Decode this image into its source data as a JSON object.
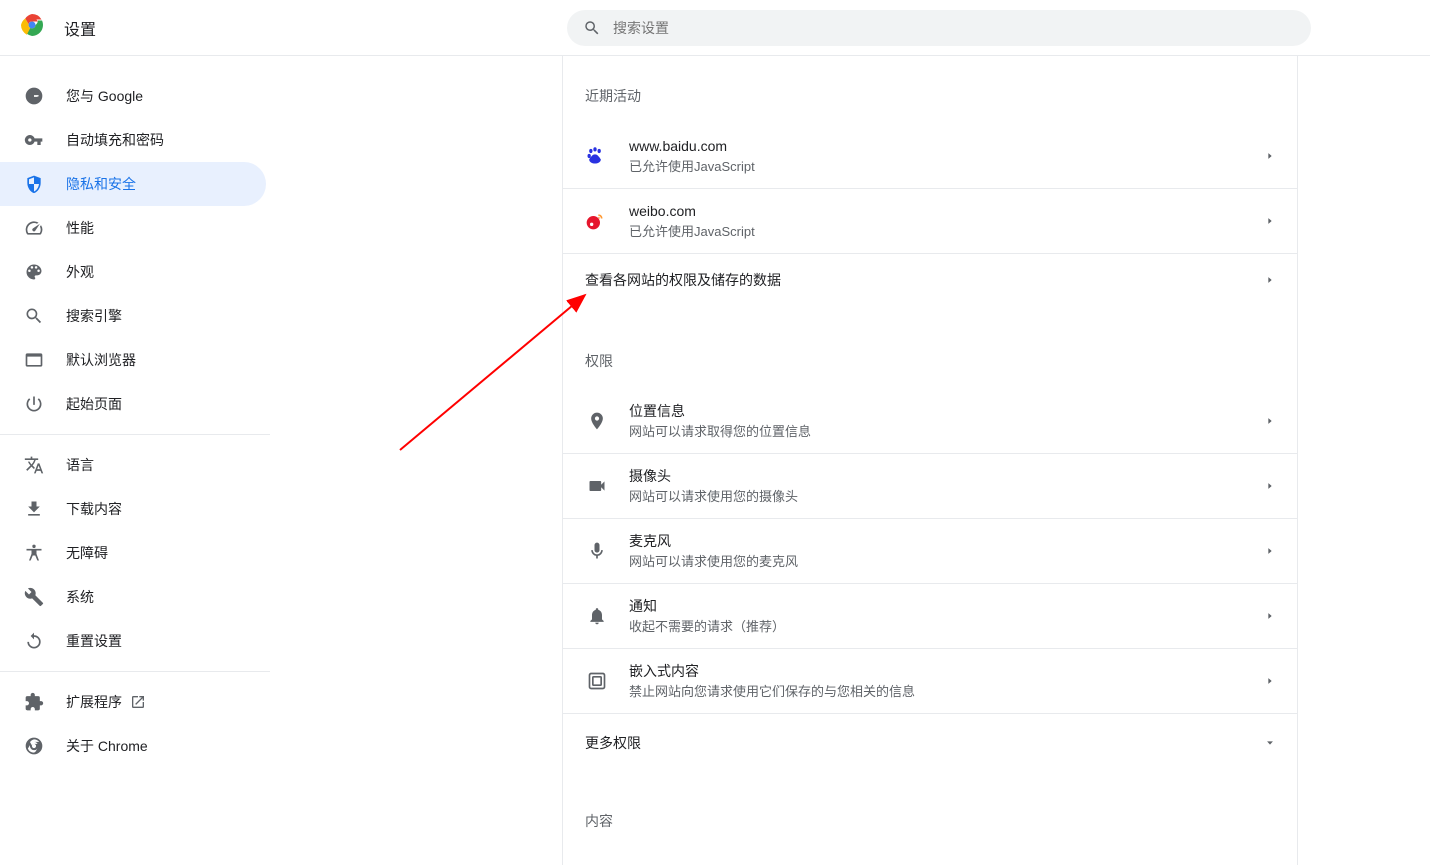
{
  "header": {
    "title": "设置",
    "search_placeholder": "搜索设置"
  },
  "sidebar": {
    "items": [
      {
        "label": "您与 Google",
        "icon": "google"
      },
      {
        "label": "自动填充和密码",
        "icon": "key"
      },
      {
        "label": "隐私和安全",
        "icon": "shield",
        "active": true
      },
      {
        "label": "性能",
        "icon": "speed"
      },
      {
        "label": "外观",
        "icon": "palette"
      },
      {
        "label": "搜索引擎",
        "icon": "search"
      },
      {
        "label": "默认浏览器",
        "icon": "browser"
      },
      {
        "label": "起始页面",
        "icon": "power"
      }
    ],
    "items2": [
      {
        "label": "语言",
        "icon": "language"
      },
      {
        "label": "下载内容",
        "icon": "download"
      },
      {
        "label": "无障碍",
        "icon": "accessibility"
      },
      {
        "label": "系统",
        "icon": "system"
      },
      {
        "label": "重置设置",
        "icon": "reset"
      }
    ],
    "items3": [
      {
        "label": "扩展程序",
        "icon": "extension",
        "external": true
      },
      {
        "label": "关于 Chrome",
        "icon": "chrome"
      }
    ]
  },
  "main": {
    "recent_section": "近期活动",
    "recent": [
      {
        "domain": "www.baidu.com",
        "status": "已允许使用JavaScript",
        "icon": "baidu"
      },
      {
        "domain": "weibo.com",
        "status": "已允许使用JavaScript",
        "icon": "weibo"
      }
    ],
    "view_all_sites": "查看各网站的权限及储存的数据",
    "permissions_section": "权限",
    "permissions": [
      {
        "title": "位置信息",
        "sub": "网站可以请求取得您的位置信息",
        "icon": "location"
      },
      {
        "title": "摄像头",
        "sub": "网站可以请求使用您的摄像头",
        "icon": "camera"
      },
      {
        "title": "麦克风",
        "sub": "网站可以请求使用您的麦克风",
        "icon": "mic"
      },
      {
        "title": "通知",
        "sub": "收起不需要的请求（推荐）",
        "icon": "bell"
      },
      {
        "title": "嵌入式内容",
        "sub": "禁止网站向您请求使用它们保存的与您相关的信息",
        "icon": "embed"
      }
    ],
    "more_permissions": "更多权限",
    "content_section": "内容"
  }
}
